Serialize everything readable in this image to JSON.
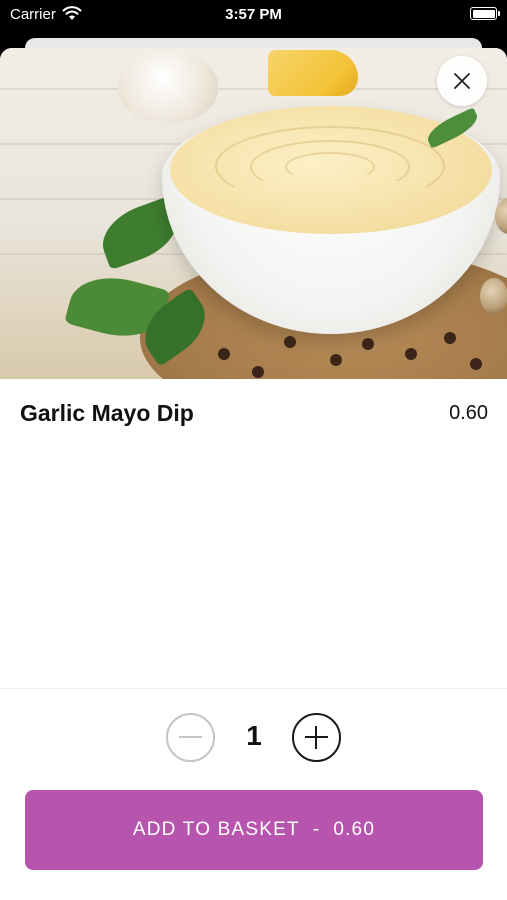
{
  "status_bar": {
    "carrier": "Carrier",
    "time": "3:57 PM"
  },
  "product": {
    "name": "Garlic Mayo Dip",
    "price": "0.60",
    "image_alt": "Garlic mayo dip in a white bowl"
  },
  "quantity": {
    "value": "1"
  },
  "add_button": {
    "label": "ADD TO BASKET",
    "separator": "-",
    "total": "0.60"
  },
  "colors": {
    "accent": "#b755ae",
    "qty_minus_disabled": "#c4c4c4",
    "qty_plus": "#1a1a1a"
  },
  "icons": {
    "close": "close-icon",
    "minus": "minus-icon",
    "plus": "plus-icon",
    "wifi": "wifi-icon",
    "battery": "battery-icon"
  }
}
